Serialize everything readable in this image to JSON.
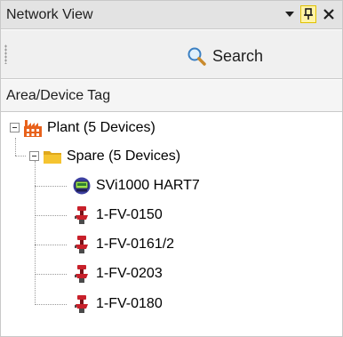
{
  "panel": {
    "title": "Network View",
    "search_label": "Search",
    "column_header": "Area/Device Tag"
  },
  "tree": {
    "plant": {
      "label": "Plant (5 Devices)",
      "icon": "factory-icon"
    },
    "spare": {
      "label": "Spare (5 Devices)",
      "icon": "folder-icon"
    },
    "devices": [
      {
        "label": "SVi1000 HART7",
        "icon": "positioner-icon"
      },
      {
        "label": "1-FV-0150",
        "icon": "valve-icon"
      },
      {
        "label": "1-FV-0161/2",
        "icon": "valve-icon"
      },
      {
        "label": "1-FV-0203",
        "icon": "valve-icon"
      },
      {
        "label": "1-FV-0180",
        "icon": "valve-icon"
      }
    ]
  },
  "colors": {
    "titlebar": "#e3e3e3",
    "pin_highlight": "#fff3a6",
    "valve_red": "#c8202a",
    "folder_yellow": "#f5c430",
    "factory_orange": "#e8621c"
  }
}
